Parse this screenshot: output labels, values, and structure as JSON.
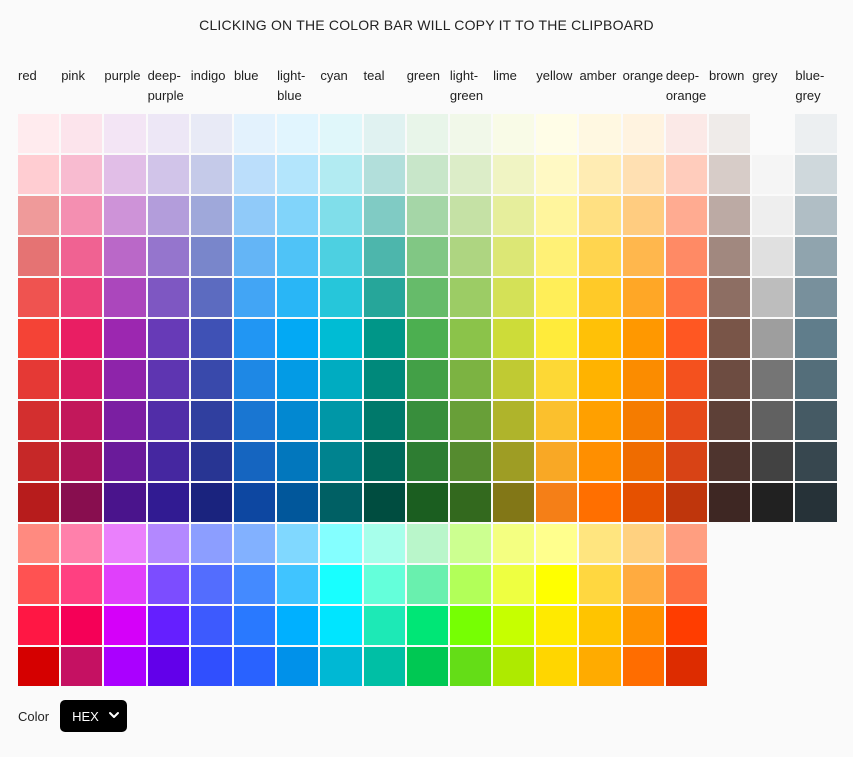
{
  "title": "CLICKING ON THE COLOR BAR WILL COPY IT TO THE CLIPBOARD",
  "footer": {
    "label": "Color",
    "format_selected": "HEX"
  },
  "palettes": [
    {
      "name": "red\n",
      "shades": [
        "#ffebee",
        "#ffcdd2",
        "#ef9a9a",
        "#e57373",
        "#ef5350",
        "#f44336",
        "#e53935",
        "#d32f2f",
        "#c62828",
        "#b71c1c",
        "#ff8a80",
        "#ff5252",
        "#ff1744",
        "#d50000"
      ]
    },
    {
      "name": "pink\n",
      "shades": [
        "#fce4ec",
        "#f8bbd0",
        "#f48fb1",
        "#f06292",
        "#ec407a",
        "#e91e63",
        "#d81b60",
        "#c2185b",
        "#ad1457",
        "#880e4f",
        "#ff80ab",
        "#ff4081",
        "#f50057",
        "#c51162"
      ]
    },
    {
      "name": "purple\n",
      "shades": [
        "#f3e5f5",
        "#e1bee7",
        "#ce93d8",
        "#ba68c8",
        "#ab47bc",
        "#9c27b0",
        "#8e24aa",
        "#7b1fa2",
        "#6a1b9a",
        "#4a148c",
        "#ea80fc",
        "#e040fb",
        "#d500f9",
        "#aa00ff"
      ]
    },
    {
      "name": "deep-\npurple",
      "shades": [
        "#ede7f6",
        "#d1c4e9",
        "#b39ddb",
        "#9575cd",
        "#7e57c2",
        "#673ab7",
        "#5e35b1",
        "#512da8",
        "#4527a0",
        "#311b92",
        "#b388ff",
        "#7c4dff",
        "#651fff",
        "#6200ea"
      ]
    },
    {
      "name": "indigo\n",
      "shades": [
        "#e8eaf6",
        "#c5cae9",
        "#9fa8da",
        "#7986cb",
        "#5c6bc0",
        "#3f51b5",
        "#3949ab",
        "#303f9f",
        "#283593",
        "#1a237e",
        "#8c9eff",
        "#536dfe",
        "#3d5afe",
        "#304ffe"
      ]
    },
    {
      "name": "blue\n",
      "shades": [
        "#e3f2fd",
        "#bbdefb",
        "#90caf9",
        "#64b5f6",
        "#42a5f5",
        "#2196f3",
        "#1e88e5",
        "#1976d2",
        "#1565c0",
        "#0d47a1",
        "#82b1ff",
        "#448aff",
        "#2979ff",
        "#2962ff"
      ]
    },
    {
      "name": "light-\nblue",
      "shades": [
        "#e1f5fe",
        "#b3e5fc",
        "#81d4fa",
        "#4fc3f7",
        "#29b6f6",
        "#03a9f4",
        "#039be5",
        "#0288d1",
        "#0277bd",
        "#01579b",
        "#80d8ff",
        "#40c4ff",
        "#00b0ff",
        "#0091ea"
      ]
    },
    {
      "name": "cyan\n",
      "shades": [
        "#e0f7fa",
        "#b2ebf2",
        "#80deea",
        "#4dd0e1",
        "#26c6da",
        "#00bcd4",
        "#00acc1",
        "#0097a7",
        "#00838f",
        "#006064",
        "#84ffff",
        "#18ffff",
        "#00e5ff",
        "#00b8d4"
      ]
    },
    {
      "name": "teal\n",
      "shades": [
        "#e0f2f1",
        "#b2dfdb",
        "#80cbc4",
        "#4db6ac",
        "#26a69a",
        "#009688",
        "#00897b",
        "#00796b",
        "#00695c",
        "#004d40",
        "#a7ffeb",
        "#64ffda",
        "#1de9b6",
        "#00bfa5"
      ]
    },
    {
      "name": "green\n",
      "shades": [
        "#e8f5e9",
        "#c8e6c9",
        "#a5d6a7",
        "#81c784",
        "#66bb6a",
        "#4caf50",
        "#43a047",
        "#388e3c",
        "#2e7d32",
        "#1b5e20",
        "#b9f6ca",
        "#69f0ae",
        "#00e676",
        "#00c853"
      ]
    },
    {
      "name": "light-\ngreen",
      "shades": [
        "#f1f8e9",
        "#dcedc8",
        "#c5e1a5",
        "#aed581",
        "#9ccc65",
        "#8bc34a",
        "#7cb342",
        "#689f38",
        "#558b2f",
        "#33691e",
        "#ccff90",
        "#b2ff59",
        "#76ff03",
        "#64dd17"
      ]
    },
    {
      "name": "lime\n",
      "shades": [
        "#f9fbe7",
        "#f0f4c3",
        "#e6ee9c",
        "#dce775",
        "#d4e157",
        "#cddc39",
        "#c0ca33",
        "#afb42b",
        "#9e9d24",
        "#827717",
        "#f4ff81",
        "#eeff41",
        "#c6ff00",
        "#aeea00"
      ]
    },
    {
      "name": "yellow\n",
      "shades": [
        "#fffde7",
        "#fff9c4",
        "#fff59d",
        "#fff176",
        "#ffee58",
        "#ffeb3b",
        "#fdd835",
        "#fbc02d",
        "#f9a825",
        "#f57f17",
        "#ffff8d",
        "#ffff00",
        "#ffea00",
        "#ffd600"
      ]
    },
    {
      "name": "amber\n",
      "shades": [
        "#fff8e1",
        "#ffecb3",
        "#ffe082",
        "#ffd54f",
        "#ffca28",
        "#ffc107",
        "#ffb300",
        "#ffa000",
        "#ff8f00",
        "#ff6f00",
        "#ffe57f",
        "#ffd740",
        "#ffc400",
        "#ffab00"
      ]
    },
    {
      "name": "orange\n",
      "shades": [
        "#fff3e0",
        "#ffe0b2",
        "#ffcc80",
        "#ffb74d",
        "#ffa726",
        "#ff9800",
        "#fb8c00",
        "#f57c00",
        "#ef6c00",
        "#e65100",
        "#ffd180",
        "#ffab40",
        "#ff9100",
        "#ff6d00"
      ]
    },
    {
      "name": "deep-\norange",
      "shades": [
        "#fbe9e7",
        "#ffccbc",
        "#ffab91",
        "#ff8a65",
        "#ff7043",
        "#ff5722",
        "#f4511e",
        "#e64a19",
        "#d84315",
        "#bf360c",
        "#ff9e80",
        "#ff6e40",
        "#ff3d00",
        "#dd2c00"
      ]
    },
    {
      "name": "brown\n",
      "shades": [
        "#efebe9",
        "#d7ccc8",
        "#bcaaa4",
        "#a1887f",
        "#8d6e63",
        "#795548",
        "#6d4c41",
        "#5d4037",
        "#4e342e",
        "#3e2723"
      ]
    },
    {
      "name": "grey\n",
      "shades": [
        "#fafafa",
        "#f5f5f5",
        "#eeeeee",
        "#e0e0e0",
        "#bdbdbd",
        "#9e9e9e",
        "#757575",
        "#616161",
        "#424242",
        "#212121"
      ]
    },
    {
      "name": "blue-\ngrey",
      "shades": [
        "#eceff1",
        "#cfd8dc",
        "#b0bec5",
        "#90a4ae",
        "#78909c",
        "#607d8b",
        "#546e7a",
        "#455a64",
        "#37474f",
        "#263238"
      ]
    }
  ]
}
